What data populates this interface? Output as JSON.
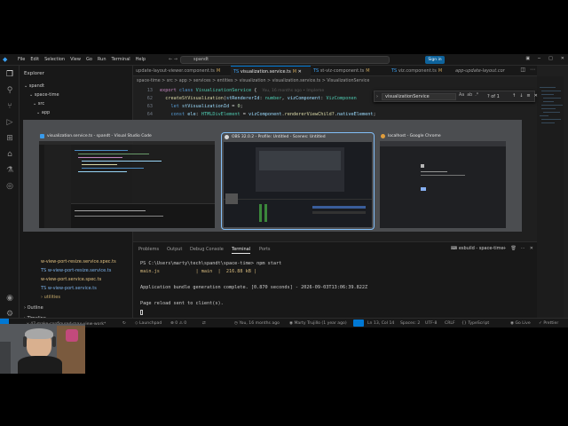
{
  "window": {
    "search_text": "spandt",
    "signin_label": "Sign in",
    "menu": [
      "File",
      "Edit",
      "Selection",
      "View",
      "Go",
      "Run",
      "Terminal",
      "Help"
    ]
  },
  "sidebar": {
    "title": "Explorer",
    "tree_top": [
      {
        "label": "spandt",
        "indent": 0
      },
      {
        "label": "space-time",
        "indent": 1
      },
      {
        "label": "src",
        "indent": 2
      },
      {
        "label": "app",
        "indent": 3
      }
    ],
    "tree_bottom": [
      {
        "label": "w-view-port-resize.service.spec.ts",
        "kind": "spec"
      },
      {
        "label": "w-view-port-resize.service.ts",
        "kind": "ts"
      },
      {
        "label": "w-view-port.service.spec.ts",
        "kind": "spec"
      },
      {
        "label": "w-view-port.service.ts",
        "kind": "ts"
      },
      {
        "label": "utilities",
        "kind": "folder"
      }
    ],
    "outline_label": "Outline",
    "timeline_label": "Timeline"
  },
  "tabs": [
    {
      "label": "update-layout-viewer.component.ts",
      "modified": "M"
    },
    {
      "label": "visualization.service.ts",
      "modified": "M",
      "active": true
    },
    {
      "label": "st-viz-component.ts",
      "modified": "M"
    },
    {
      "label": "viz.component.ts",
      "modified": "M"
    },
    {
      "label": "app-update-layout.cor",
      "modified": ""
    }
  ],
  "breadcrumbs": "space-time > src > app > services > entities > visualization > visualization.service.ts > VisualizationService",
  "editor": {
    "lines": [
      {
        "n": "13",
        "tokens": [
          [
            "kw2",
            "export "
          ],
          [
            "kw",
            "class "
          ],
          [
            "cls",
            "VisualizationService"
          ],
          [
            "pl",
            " {"
          ]
        ],
        "blame": "You, 16 months ago • Impleme"
      },
      {
        "n": "62",
        "tokens": [
          [
            "pl",
            "  "
          ],
          [
            "fn",
            "createStVisualization"
          ],
          [
            "pl",
            "("
          ],
          [
            "vr",
            "stRendererId"
          ],
          [
            "pl",
            ": "
          ],
          [
            "cls",
            "number"
          ],
          [
            "pl",
            ", "
          ],
          [
            "vr",
            "vizComponent"
          ],
          [
            "pl",
            ": "
          ],
          [
            "cls",
            "VizComponen"
          ]
        ],
        "blame": ""
      },
      {
        "n": "63",
        "tokens": [
          [
            "pl",
            "    "
          ],
          [
            "kw",
            "let "
          ],
          [
            "vr",
            "stVisualizationId"
          ],
          [
            "pl",
            " = "
          ],
          [
            "nm",
            "0"
          ],
          [
            "pl",
            ";"
          ]
        ],
        "blame": ""
      },
      {
        "n": "64",
        "tokens": [
          [
            "pl",
            "    "
          ],
          [
            "kw",
            "const "
          ],
          [
            "vr",
            "ele"
          ],
          [
            "pl",
            ": "
          ],
          [
            "cls",
            "HTMLDivElement"
          ],
          [
            "pl",
            " = "
          ],
          [
            "vr",
            "vizComponent"
          ],
          [
            "pl",
            "."
          ],
          [
            "fn",
            "rendererViewChild?"
          ],
          [
            "pl",
            "."
          ],
          [
            "vr",
            "nativeElement"
          ],
          [
            "pl",
            ";"
          ]
        ],
        "blame": ""
      }
    ]
  },
  "find": {
    "query": "visualizationService",
    "options": [
      "Aa",
      "ab",
      ".*"
    ],
    "count": "? of 1"
  },
  "switcher": {
    "windows": [
      {
        "title": "visualization.service.ts - spandt - Visual Studio Code",
        "color": "#3aa0f3",
        "selected": false
      },
      {
        "title": "OBS 32.0.2 - Profile: Untitled - Scenes: Untitled",
        "color": "#dddddd",
        "selected": true
      },
      {
        "title": "localhost - Google Chrome",
        "color": "#e8a33d",
        "selected": false
      }
    ]
  },
  "panel": {
    "tabs": [
      "Problems",
      "Output",
      "Debug Console",
      "Terminal",
      "Ports"
    ],
    "active_tab": "Terminal",
    "terminal_name": "esbuild - space-time",
    "lines": [
      {
        "text": "PS C:\\Users\\marty\\tech\\spandt\\space-time> npm start",
        "color": "#cccccc"
      },
      {
        "text": "main.js             | main  |  216.88 kB |",
        "color": "#d7ba7d"
      },
      {
        "text": "",
        "color": "#cccccc"
      },
      {
        "text": "Application bundle generation complete. [0.870 seconds] - 2026-09-03T13:06:39.822Z",
        "color": "#cccccc"
      },
      {
        "text": "",
        "color": "#cccccc"
      },
      {
        "text": "Page reload sent to client(s).",
        "color": "#cccccc"
      }
    ]
  },
  "statusbar": {
    "branch": "47-make-configured-max-view-work*",
    "sync": "↻",
    "launchpad": "Launchpad",
    "problems": "⊗ 0  ⚠ 0",
    "blame_now": "You, 16 months ago",
    "blame_author": "Marty Trujillo (1 year ago)",
    "position": "Ln 13, Col 14",
    "spaces": "Spaces: 2",
    "encoding": "UTF-8",
    "eol": "CRLF",
    "language": "TypeScript",
    "golive": "Go Live",
    "prettier": "Prettier"
  }
}
